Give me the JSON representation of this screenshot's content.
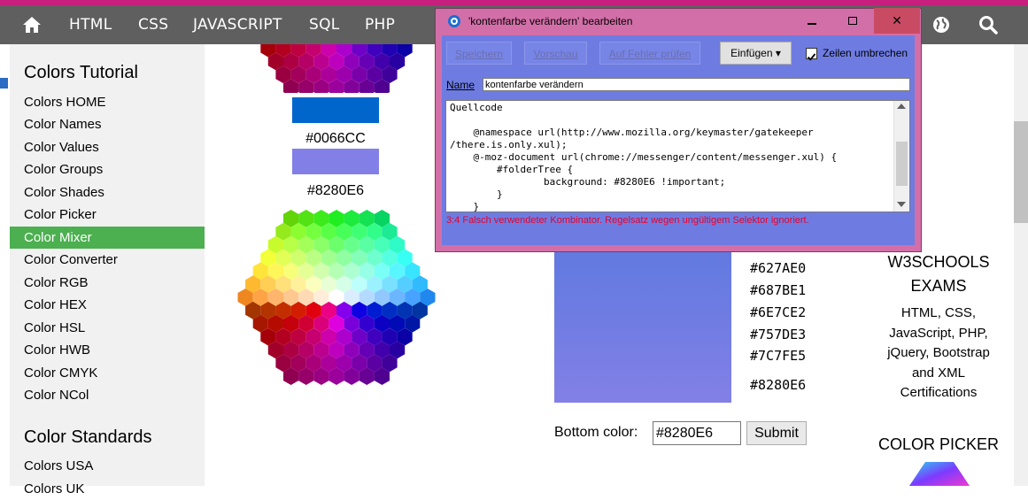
{
  "nav": {
    "items": [
      "HTML",
      "CSS",
      "JAVASCRIPT",
      "SQL",
      "PHP"
    ],
    "home_icon": "home-icon",
    "globe_icon": "globe-icon",
    "search_icon": "search-icon"
  },
  "sidebar": {
    "title": "Colors Tutorial",
    "items": [
      "Colors HOME",
      "Color Names",
      "Color Values",
      "Color Groups",
      "Color Shades",
      "Color Picker",
      "Color Mixer",
      "Color Converter",
      "Color RGB",
      "Color HEX",
      "Color HSL",
      "Color HWB",
      "Color CMYK",
      "Color NCol"
    ],
    "active_item": "Color Mixer",
    "title2": "Color Standards",
    "items2": [
      "Colors USA",
      "Colors UK"
    ]
  },
  "swatches": [
    {
      "hex": "#0066CC",
      "color": "#0066cc"
    },
    {
      "hex": "#8280E6",
      "color": "#8280e6"
    }
  ],
  "dialog": {
    "title": "'kontenfarbe verändern' bearbeiten",
    "buttons": {
      "save": "Speichern",
      "preview": "Vorschau",
      "check": "Auf Fehler prüfen",
      "insert": "Einfügen ▾",
      "wrap": "Zeilen umbrechen"
    },
    "wrap_checked": true,
    "name_label": "Name",
    "name_value": "kontenfarbe verändern",
    "code_label": "Quellcode",
    "code_lines": [
      "",
      "    @namespace url(http://www.mozilla.org/keymaster/gatekeeper",
      "/there.is.only.xul);",
      "    @-moz-document url(chrome://messenger/content/messenger.xul) {",
      "        #folderTree {",
      "                background: #8280E6 !important;",
      "        }",
      "    }"
    ],
    "error": "3:4 Falsch verwendeter Kombinator. Regelsatz wegen ungültigem Selektor ignoriert."
  },
  "mixer": {
    "hex_values": [
      "#627AE0",
      "#687BE1",
      "#6E7CE2",
      "#757DE3",
      "#7C7FE5",
      "#8280E6"
    ],
    "colors": [
      "#627ae0",
      "#687be1",
      "#6e7ce2",
      "#757de3",
      "#7c7fe5",
      "#8280e6"
    ],
    "bottom_label": "Bottom color:",
    "bottom_value": "#8280E6",
    "submit": "Submit"
  },
  "ad": {
    "heading_line1": "W3SCHOOLS",
    "heading_line2": "EXAMS",
    "text": [
      "HTML, CSS,",
      "JavaScript, PHP,",
      "jQuery, Bootstrap",
      "and XML",
      "Certifications"
    ],
    "picker_heading": "COLOR PICKER"
  }
}
